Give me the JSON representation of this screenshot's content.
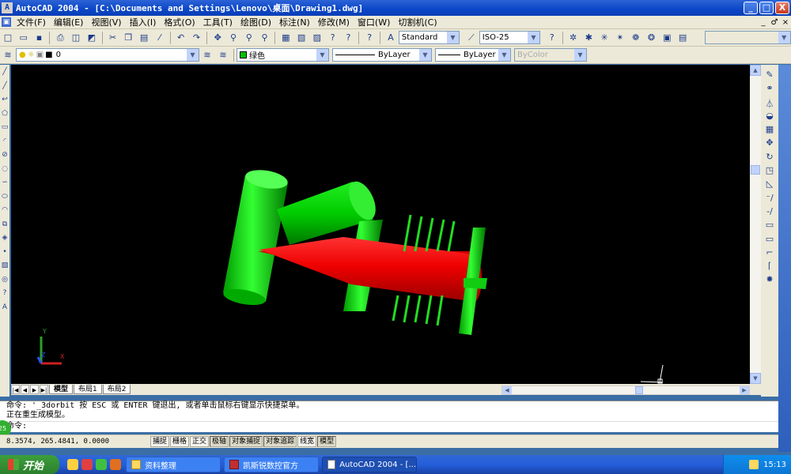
{
  "window": {
    "title": "AutoCAD 2004 - [C:\\Documents and Settings\\Lenovo\\桌面\\Drawing1.dwg]",
    "app_icon_letter": "A",
    "minimize_label": "_",
    "maximize_label": "□",
    "close_label": "X"
  },
  "menubar": {
    "items": [
      "文件(F)",
      "编辑(E)",
      "视图(V)",
      "插入(I)",
      "格式(O)",
      "工具(T)",
      "绘图(D)",
      "标注(N)",
      "修改(M)",
      "窗口(W)",
      "切割机(C)"
    ],
    "doc_controls": [
      "_",
      "♂",
      "×"
    ]
  },
  "toolbar1": {
    "text_style": "Standard",
    "dim_style": "ISO-25"
  },
  "toolbar2": {
    "layer": "0",
    "color": "绿色",
    "linetype": "ByLayer",
    "lineweight": "ByLayer",
    "plotstyle": "ByColor"
  },
  "layout_tabs": [
    "模型",
    "布局1",
    "布局2"
  ],
  "command": {
    "line1": "命令: '_3dorbit 按 ESC 或 ENTER 键退出, 或者单击鼠标右键显示快捷菜单。",
    "line2": "正在重生成模型。",
    "prompt": "命令:"
  },
  "status": {
    "coords": "8.3574, 265.4841, 0.0000",
    "toggles": [
      "捕捉",
      "栅格",
      "正交",
      "极轴",
      "对象捕捉",
      "对象追踪",
      "线宽",
      "模型"
    ]
  },
  "ucs": {
    "x": "X",
    "y": "Y",
    "z": "Z"
  },
  "side_badge": "25",
  "taskbar": {
    "start": "开始",
    "tasks": [
      "资料整理",
      "凯斯锐数控官方",
      "AutoCAD 2004 - [..."
    ],
    "clock": "15:13"
  },
  "colors": {
    "green": "#00e000",
    "red": "#e01010",
    "canvas": "#000000"
  }
}
